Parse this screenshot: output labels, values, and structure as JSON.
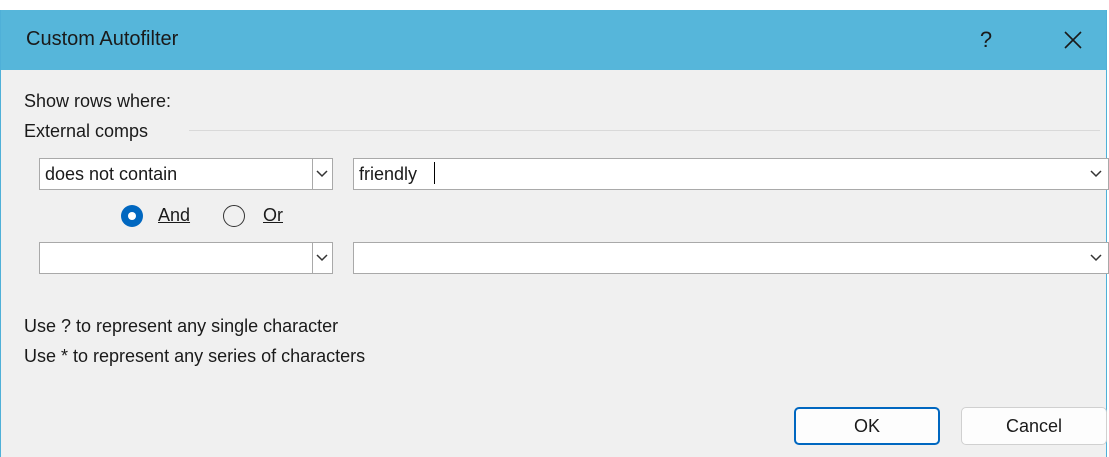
{
  "dialog": {
    "title": "Custom Autofilter",
    "help_label": "?",
    "show_rows_label": "Show rows where:",
    "column_name": "External comps"
  },
  "criteria": [
    {
      "operator": "does not contain",
      "value": "friendly"
    },
    {
      "operator": "",
      "value": ""
    }
  ],
  "logic": {
    "and_label": "And",
    "or_label": "Or",
    "selected": "And"
  },
  "hints": [
    "Use ? to represent any single character",
    "Use * to represent any series of characters"
  ],
  "buttons": {
    "ok": "OK",
    "cancel": "Cancel"
  },
  "colors": {
    "titlebar": "#56b6da",
    "accent": "#0067c0",
    "body": "#f0f0f0"
  }
}
